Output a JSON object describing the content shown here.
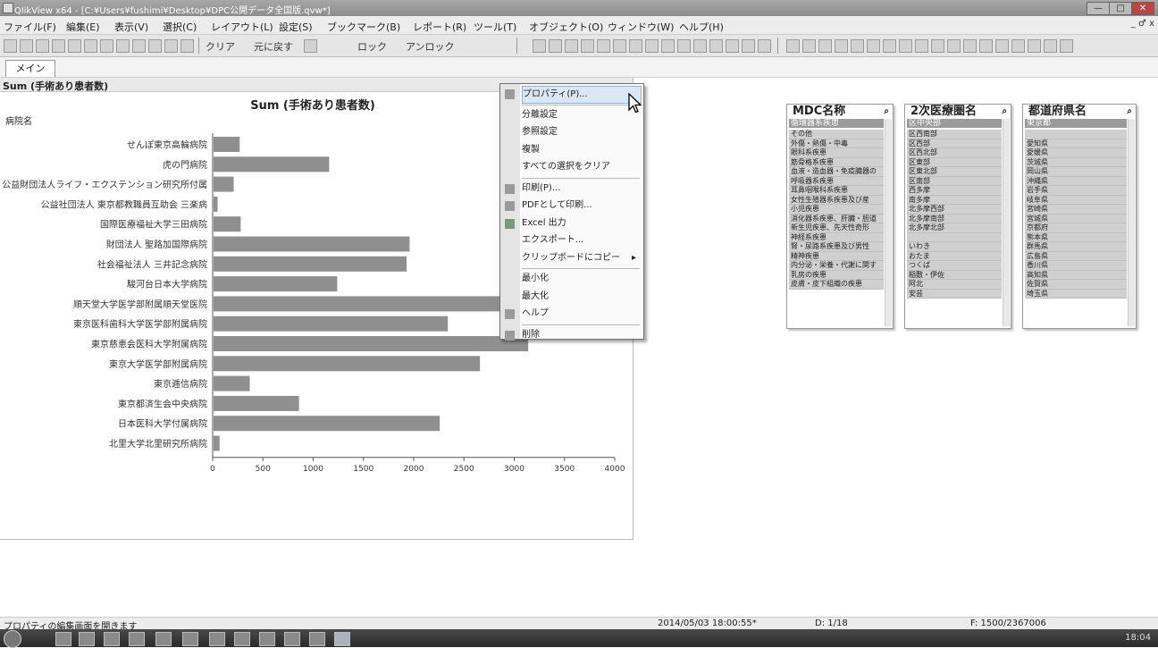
{
  "window": {
    "title": "QlikView x64 - [C:¥Users¥fushimi¥Desktop¥DPC公開データ全国版.qvw*]",
    "controls": {
      "minimize": "—",
      "maximize": "□",
      "close": "✕"
    }
  },
  "menubar": {
    "items": [
      "ファイル(F)",
      "編集(E)",
      "表示(V)",
      "選択(C)",
      "レイアウト(L)",
      "設定(S)",
      "ブックマーク(B)",
      "レポート(R)",
      "ツール(T)",
      "オブジェクト(O)",
      "ウィンドウ(W)",
      "ヘルプ(H)"
    ],
    "mdi": "_ ♂ x"
  },
  "toolbar": {
    "clear_label": "クリア",
    "back_label": "元に戻す",
    "lock_label": "ロック",
    "unlock_label": "アンロック"
  },
  "tabs": [
    {
      "label": "メイン"
    }
  ],
  "chart": {
    "caption": "Sum (手術あり患者数)",
    "caption_buttons": "XL ＿ □",
    "dimension_label": "病院名"
  },
  "chart_data": {
    "type": "bar",
    "orientation": "horizontal",
    "title": "Sum (手術あり患者数)",
    "categories": [
      "せんぽ東京高輪病院",
      "虎の門病院",
      "公益財団法人ライフ・エクステンション研究所付属",
      "公益社団法人 東京都教職員互助会 三楽病",
      "国際医療福祉大学三田病院",
      "財団法人 聖路加国際病院",
      "社会福祉法人 三井記念病院",
      "駿河台日本大学病院",
      "順天堂大学医学部附属順天堂医院",
      "東京医科歯科大学医学部附属病院",
      "東京慈恵会医科大学附属病院",
      "東京大学医学部附属病院",
      "東京逓信病院",
      "東京都済生会中央病院",
      "日本医科大学付属病院",
      "北里大学北里研究所病院"
    ],
    "values": [
      260,
      1150,
      200,
      40,
      270,
      1950,
      1920,
      1230,
      3450,
      2330,
      3130,
      2650,
      360,
      850,
      2250,
      60
    ],
    "xlim": [
      0,
      4000
    ],
    "xticks": [
      "0",
      "500",
      "1000",
      "1500",
      "2000",
      "2500",
      "3000",
      "3500",
      "4000"
    ],
    "bar_color": "#8f8f8f"
  },
  "context_menu": {
    "items": [
      {
        "label": "プロパティ(P)...",
        "icon": "properties-icon"
      },
      {
        "label": "分離設定",
        "icon": ""
      },
      {
        "label": "参照設定",
        "icon": ""
      },
      {
        "label": "複製",
        "icon": ""
      },
      {
        "label": "すべての選択をクリア",
        "icon": ""
      },
      {
        "label": "印刷(P)...",
        "icon": "printer-icon"
      },
      {
        "label": "PDFとして印刷...",
        "icon": "pdf-icon"
      },
      {
        "label": "Excel 出力",
        "icon": "excel-icon"
      },
      {
        "label": "エクスポート...",
        "icon": ""
      },
      {
        "label": "クリップボードにコピー",
        "icon": ""
      },
      {
        "label": "最小化",
        "icon": ""
      },
      {
        "label": "最大化",
        "icon": ""
      },
      {
        "label": "ヘルプ",
        "icon": "help-icon"
      },
      {
        "label": "削除",
        "icon": "delete-icon"
      }
    ]
  },
  "listboxes": [
    {
      "title": "MDC名称",
      "selected": "循環器系疾患",
      "items": [
        "その他",
        "外傷・熱傷・中毒",
        "眼科系疾患",
        "筋骨格系疾患",
        "血液・造血器・免疫臓器の",
        "呼吸器系疾患",
        "耳鼻咽喉科系疾患",
        "女性生殖器系疾患及び産",
        "小児疾患",
        "消化器系疾患、肝臓・胆道",
        "新生児疾患、先天性奇形",
        "神経系疾患",
        "腎・尿路系疾患及び男性",
        "精神疾患",
        "内分泌・栄養・代謝に関す",
        "乳房の疾患",
        "皮膚・皮下組織の疾患"
      ]
    },
    {
      "title": "2次医療圏名",
      "selected": "区中央部",
      "items": [
        "区西南部",
        "区西部",
        "区西北部",
        "区東部",
        "区東北部",
        "区南部",
        "西多摩",
        "南多摩",
        "北多摩西部",
        "北多摩南部",
        "北多摩北部",
        "",
        "いわき",
        "おたま",
        "つくば",
        "稲敷・伊佐",
        "阿北",
        "安芸"
      ]
    },
    {
      "title": "都道府県名",
      "selected": "東京都",
      "items": [
        "",
        "愛知県",
        "愛媛県",
        "茨城県",
        "岡山県",
        "沖縄県",
        "岩手県",
        "岐阜県",
        "宮崎県",
        "宮城県",
        "京都府",
        "熊本県",
        "群馬県",
        "広島県",
        "香川県",
        "高知県",
        "佐賀県",
        "埼玉県"
      ]
    }
  ],
  "statusbar": {
    "hint": "プロパティの編集画面を開きます",
    "datetime": "2014/05/03 18:00:55*",
    "doc": "D: 1/18",
    "filter": "F: 1500/2367006"
  },
  "taskbar": {
    "clock": "18:04"
  }
}
